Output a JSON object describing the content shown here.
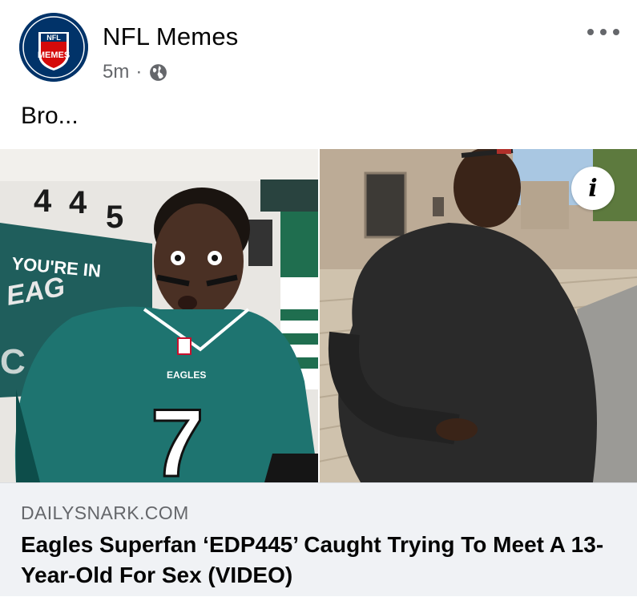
{
  "post": {
    "page_name": "NFL Memes",
    "timestamp": "5m",
    "separator": "·",
    "audience_icon": "globe-icon",
    "text": "Bro...",
    "more_icon": "more-options-icon"
  },
  "avatar": {
    "logo_top": "NFL",
    "logo_bottom": "MEMES",
    "colors": {
      "navy": "#013369",
      "red": "#d50a0a",
      "white": "#ffffff"
    }
  },
  "link": {
    "domain": "DAILYSNARK.COM",
    "headline": "Eagles Superfan ‘EDP445’ Caught Trying To Meet A 13-Year-Old For Sex (VIDEO)",
    "info_label": "i",
    "image": {
      "left_photo": {
        "wall_numbers": "4 4 5",
        "banner_text": "YOU'RE IN",
        "banner_text_2": "EAGLES",
        "jersey_number": "7",
        "jersey_wordmark": "EAGLES"
      },
      "right_photo": "man-in-black-sweatshirt"
    }
  },
  "colors": {
    "text_primary": "#050505",
    "text_secondary": "#65676b",
    "footer_bg": "#f0f2f5",
    "eagles_green": "#1f6e6a"
  }
}
